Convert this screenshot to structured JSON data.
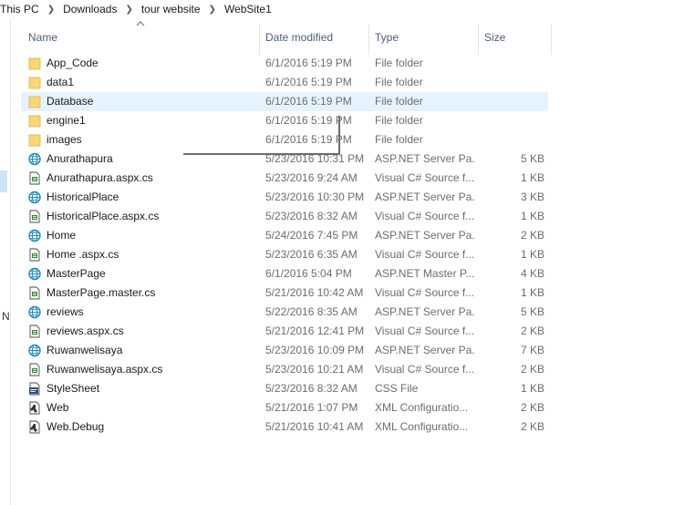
{
  "breadcrumb": [
    "This PC",
    "Downloads",
    "tour website",
    "WebSite1"
  ],
  "nav": {
    "partial_letter": "N"
  },
  "columns": {
    "name": "Name",
    "date": "Date modified",
    "type": "Type",
    "size": "Size"
  },
  "selected_row": 2,
  "files": [
    {
      "name": "App_Code",
      "date": "6/1/2016 5:19 PM",
      "type": "File folder",
      "size": "",
      "icon": "folder-icon"
    },
    {
      "name": "data1",
      "date": "6/1/2016 5:19 PM",
      "type": "File folder",
      "size": "",
      "icon": "folder-icon"
    },
    {
      "name": "Database",
      "date": "6/1/2016 5:19 PM",
      "type": "File folder",
      "size": "",
      "icon": "folder-icon"
    },
    {
      "name": "engine1",
      "date": "6/1/2016 5:19 PM",
      "type": "File folder",
      "size": "",
      "icon": "folder-icon"
    },
    {
      "name": "images",
      "date": "6/1/2016 5:19 PM",
      "type": "File folder",
      "size": "",
      "icon": "folder-icon"
    },
    {
      "name": "Anurathapura",
      "date": "5/23/2016 10:31 PM",
      "type": "ASP.NET Server Pa...",
      "size": "5 KB",
      "icon": "aspx-globe-icon"
    },
    {
      "name": "Anurathapura.aspx.cs",
      "date": "5/23/2016 9:24 AM",
      "type": "Visual C# Source f...",
      "size": "1 KB",
      "icon": "csharp-file-icon"
    },
    {
      "name": "HistoricalPlace",
      "date": "5/23/2016 10:30 PM",
      "type": "ASP.NET Server Pa...",
      "size": "3 KB",
      "icon": "aspx-globe-icon"
    },
    {
      "name": "HistoricalPlace.aspx.cs",
      "date": "5/23/2016 8:32 AM",
      "type": "Visual C# Source f...",
      "size": "1 KB",
      "icon": "csharp-file-icon"
    },
    {
      "name": "Home",
      "date": "5/24/2016 7:45 PM",
      "type": "ASP.NET Server Pa...",
      "size": "2 KB",
      "icon": "aspx-globe-icon"
    },
    {
      "name": "Home .aspx.cs",
      "date": "5/23/2016 6:35 AM",
      "type": "Visual C# Source f...",
      "size": "1 KB",
      "icon": "csharp-file-icon"
    },
    {
      "name": "MasterPage",
      "date": "6/1/2016 5:04 PM",
      "type": "ASP.NET Master P...",
      "size": "4 KB",
      "icon": "aspx-globe-icon"
    },
    {
      "name": "MasterPage.master.cs",
      "date": "5/21/2016 10:42 AM",
      "type": "Visual C# Source f...",
      "size": "1 KB",
      "icon": "csharp-file-icon"
    },
    {
      "name": "reviews",
      "date": "5/22/2016 8:35 AM",
      "type": "ASP.NET Server Pa...",
      "size": "5 KB",
      "icon": "aspx-globe-icon"
    },
    {
      "name": "reviews.aspx.cs",
      "date": "5/21/2016 12:41 PM",
      "type": "Visual C# Source f...",
      "size": "2 KB",
      "icon": "csharp-file-icon"
    },
    {
      "name": "Ruwanwelisaya",
      "date": "5/23/2016 10:09 PM",
      "type": "ASP.NET Server Pa...",
      "size": "7 KB",
      "icon": "aspx-globe-icon"
    },
    {
      "name": "Ruwanwelisaya.aspx.cs",
      "date": "5/23/2016 10:21 AM",
      "type": "Visual C# Source f...",
      "size": "2 KB",
      "icon": "csharp-file-icon"
    },
    {
      "name": "StyleSheet",
      "date": "5/23/2016 8:32 AM",
      "type": "CSS File",
      "size": "1 KB",
      "icon": "css-file-icon"
    },
    {
      "name": "Web",
      "date": "5/21/2016 1:07 PM",
      "type": "XML Configuratio...",
      "size": "2 KB",
      "icon": "config-file-icon"
    },
    {
      "name": "Web.Debug",
      "date": "5/21/2016 10:41 AM",
      "type": "XML Configuratio...",
      "size": "2 KB",
      "icon": "config-file-icon"
    }
  ],
  "colors": {
    "selected_row_bg": "#e5f3ff",
    "folder": "#f8d775",
    "globe": "#1e8bc3",
    "header_text": "#4c607a"
  }
}
